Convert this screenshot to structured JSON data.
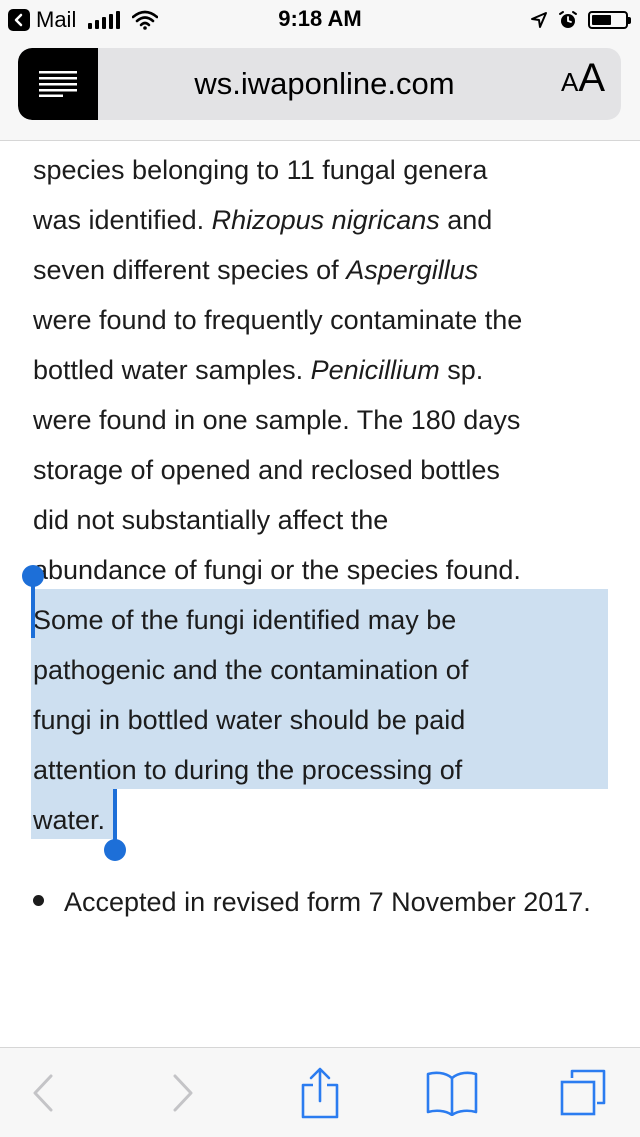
{
  "status_bar": {
    "back_app": "Mail",
    "time": "9:18 AM",
    "battery_level": 0.6
  },
  "address_bar": {
    "url": "ws.iwaponline.com",
    "text_size_small": "A",
    "text_size_large": "A"
  },
  "article": {
    "lines": [
      {
        "parts": [
          {
            "t": "species belonging to 11 fungal genera"
          }
        ]
      },
      {
        "parts": [
          {
            "t": "was identified. "
          },
          {
            "t": "Rhizopus nigricans",
            "i": true
          },
          {
            "t": " and"
          }
        ]
      },
      {
        "parts": [
          {
            "t": "seven different species of "
          },
          {
            "t": "Aspergillus",
            "i": true
          }
        ]
      },
      {
        "parts": [
          {
            "t": "were found to frequently contaminate the"
          }
        ]
      },
      {
        "parts": [
          {
            "t": "bottled water samples. "
          },
          {
            "t": "Penicillium",
            "i": true
          },
          {
            "t": " sp."
          }
        ]
      },
      {
        "parts": [
          {
            "t": "were found in one sample. The 180 days"
          }
        ]
      },
      {
        "parts": [
          {
            "t": "storage of opened and reclosed bottles"
          }
        ]
      },
      {
        "parts": [
          {
            "t": "did not substantially affect the"
          }
        ]
      },
      {
        "parts": [
          {
            "t": "abundance of fungi or the species found."
          }
        ]
      },
      {
        "parts": [
          {
            "t": "Some of the fungi identified may be"
          }
        ]
      },
      {
        "parts": [
          {
            "t": "pathogenic and the contamination of"
          }
        ]
      },
      {
        "parts": [
          {
            "t": "fungi in bottled water should be paid"
          }
        ]
      },
      {
        "parts": [
          {
            "t": "attention to during the processing of"
          }
        ]
      },
      {
        "parts": [
          {
            "t": "water."
          }
        ]
      }
    ],
    "bullet": "Accepted in revised form 7 November 2017."
  },
  "toolbar": {
    "icons": [
      "back-arrow-icon",
      "forward-arrow-icon",
      "share-icon",
      "bookmarks-icon",
      "tabs-icon"
    ]
  },
  "colors": {
    "selection": "#cddff0",
    "selection_handle": "#1d6fd8",
    "ios_blue": "#2b7cf0",
    "disabled": "#c4c4c7"
  }
}
